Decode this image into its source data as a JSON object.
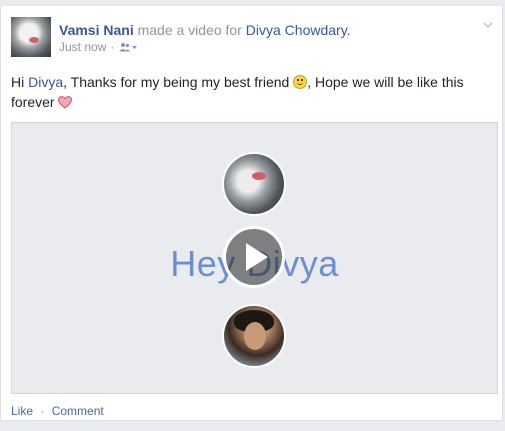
{
  "post": {
    "author": "Vamsi Nani",
    "action_text": "made a video for",
    "recipient": "Divya Chowdary.",
    "timestamp": "Just now",
    "meta_separator": "·",
    "audience_icon": "friends-icon",
    "menu_icon": "chevron-down-icon"
  },
  "message": {
    "greeting": "Hi ",
    "mention": "Divya",
    "body": ", Thanks for my being my best friend ",
    "emoji_1": "smile-emoji",
    "body_2": ", Hope we will be like this forever ",
    "emoji_2": "heart-emoji"
  },
  "video": {
    "title": "Hey Divya",
    "play_icon": "play-icon"
  },
  "actions": {
    "like": "Like",
    "separator": "·",
    "comment": "Comment"
  },
  "colors": {
    "link": "#365899",
    "meta": "#90949c",
    "video_title": "#6c8fd3",
    "background": "#e9ebee"
  }
}
